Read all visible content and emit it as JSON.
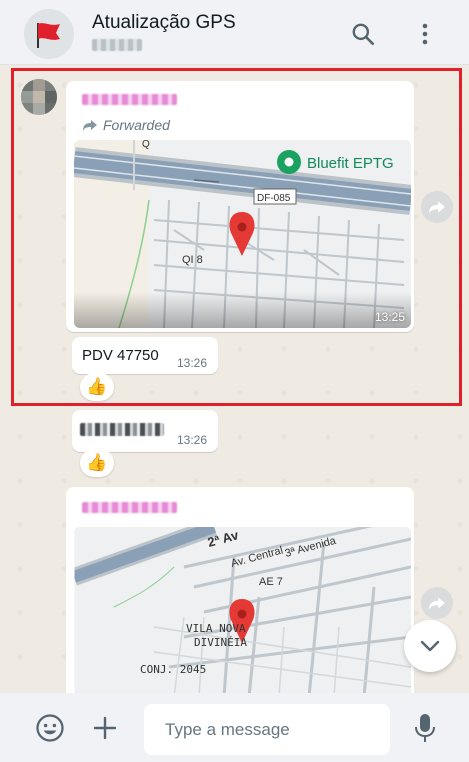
{
  "header": {
    "title": "Atualização GPS",
    "avatar_icon": "red-flag-icon",
    "search_icon": "search-icon",
    "menu_icon": "more-vertical-icon"
  },
  "messages": {
    "first": {
      "forwarded_label": "Forwarded",
      "map_place_label": "Bluefit EPTG",
      "map_road_label": "DF-085",
      "map_area_label": "QI 8",
      "map_street_label": "Q",
      "map_time": "13:25"
    },
    "pdv": {
      "text": "PDV 47750",
      "time": "13:26",
      "reaction": "👍"
    },
    "second": {
      "time": "13:26",
      "reaction": "👍"
    },
    "third": {
      "street_1": "2ª Av",
      "street_2": "Av. Central",
      "street_3": "3ª Avenida",
      "street_4": "AE 7",
      "area_1": "VILA NOVA",
      "area_2": "DIVINÉIA",
      "area_3": "CONJ. 2045"
    }
  },
  "composer": {
    "placeholder": "Type a message",
    "emoji_icon": "emoji-icon",
    "attach_icon": "plus-icon",
    "mic_icon": "microphone-icon"
  },
  "colors": {
    "highlight_border": "#e0212b",
    "pin": "#e53935",
    "place_marker": "#1aa260",
    "place_text": "#118a5a"
  }
}
